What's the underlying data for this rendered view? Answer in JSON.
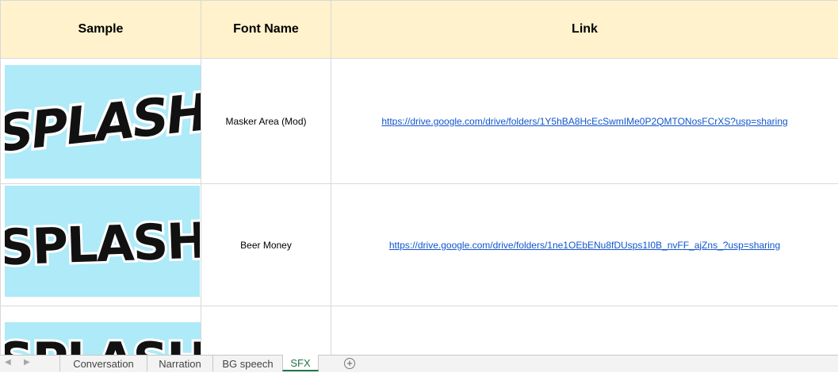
{
  "header": {
    "sample": "Sample",
    "font_name": "Font Name",
    "link": "Link"
  },
  "rows": [
    {
      "sample_text": "SPLASH",
      "font_name": "Masker Area (Mod)",
      "link": "https://drive.google.com/drive/folders/1Y5hBA8HcEcSwmIMe0P2QMTONosFCrXS?usp=sharing"
    },
    {
      "sample_text": "SPLASH",
      "font_name": "Beer Money",
      "link": "https://drive.google.com/drive/folders/1ne1OEbENu8fDUsps1I0B_nvFF_ajZns_?usp=sharing"
    },
    {
      "sample_text": "SPLASH",
      "font_name": "",
      "link": ""
    }
  ],
  "sheet_tabs": [
    {
      "label": "Conversation",
      "active": false
    },
    {
      "label": "Narration",
      "active": false
    },
    {
      "label": "BG speech",
      "active": false
    },
    {
      "label": "SFX",
      "active": true
    }
  ],
  "icons": {
    "prev": "scroll-left-icon",
    "next": "scroll-right-icon",
    "add": "add-sheet-icon"
  },
  "colors": {
    "header_bg": "#fff2cc",
    "sample_bg": "#aeeaf8",
    "link": "#1155cc",
    "active_tab": "#217346"
  }
}
